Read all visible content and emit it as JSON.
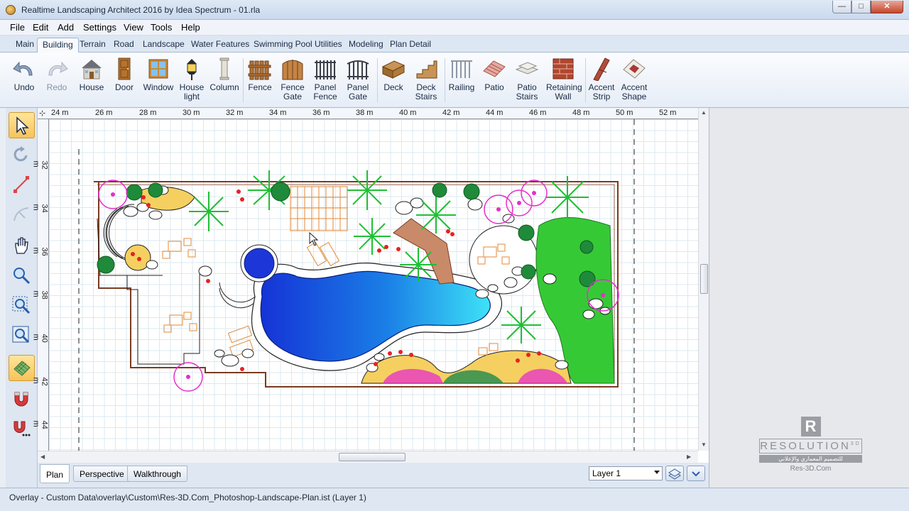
{
  "window": {
    "title": "Realtime Landscaping Architect 2016 by Idea Spectrum - 01.rla",
    "min_label": "—",
    "max_label": "□",
    "close_label": "✕"
  },
  "menu": [
    "File",
    "Edit",
    "Add",
    "Settings",
    "View",
    "Tools",
    "Help"
  ],
  "tabs": [
    "Main",
    "Building",
    "Terrain",
    "Road",
    "Landscape",
    "Water Features",
    "Swimming Pool",
    "Utilities",
    "Modeling",
    "Plan Detail"
  ],
  "active_tab": "Building",
  "ribbon": {
    "undo": "Undo",
    "redo": "Redo",
    "house": "House",
    "door": "Door",
    "window": "Window",
    "house_light_1": "House",
    "house_light_2": "light",
    "column": "Column",
    "fence": "Fence",
    "fence_gate_1": "Fence",
    "fence_gate_2": "Gate",
    "panel_fence_1": "Panel",
    "panel_fence_2": "Fence",
    "panel_gate_1": "Panel",
    "panel_gate_2": "Gate",
    "deck": "Deck",
    "deck_stairs_1": "Deck",
    "deck_stairs_2": "Stairs",
    "railing": "Railing",
    "patio": "Patio",
    "patio_stairs_1": "Patio",
    "patio_stairs_2": "Stairs",
    "retaining_wall_1": "Retaining",
    "retaining_wall_2": "Wall",
    "accent_strip_1": "Accent",
    "accent_strip_2": "Strip",
    "accent_shape_1": "Accent",
    "accent_shape_2": "Shape"
  },
  "ruler": {
    "x_ticks": [
      "24 m",
      "26 m",
      "28 m",
      "30 m",
      "32 m",
      "34 m",
      "36 m",
      "38 m",
      "40 m",
      "42 m",
      "44 m",
      "46 m",
      "48 m",
      "50 m",
      "52 m"
    ],
    "y_ticks": [
      "32 m",
      "34 m",
      "36 m",
      "38 m",
      "40 m",
      "42 m",
      "44 m"
    ]
  },
  "view_tabs": [
    "Plan",
    "Perspective",
    "Walkthrough"
  ],
  "active_view": "Plan",
  "layer": "Layer 1",
  "logo": {
    "letter": "R",
    "word": "RESOLUTION",
    "sup": "3D",
    "arabic": "للتصميم المعماري والإعلاني",
    "site": "Res-3D.Com"
  },
  "status": "Overlay - Custom Data\\overlay\\Custom\\Res-3D.Com_Photoshop-Landscape-Plan.ist (Layer 1)",
  "colors": {
    "accent": "#f7c35a",
    "pool_deep": "#1a3fd6",
    "pool_shallow": "#2cc8f0",
    "lawn": "#34c934",
    "flowers": "#e62ecb"
  }
}
